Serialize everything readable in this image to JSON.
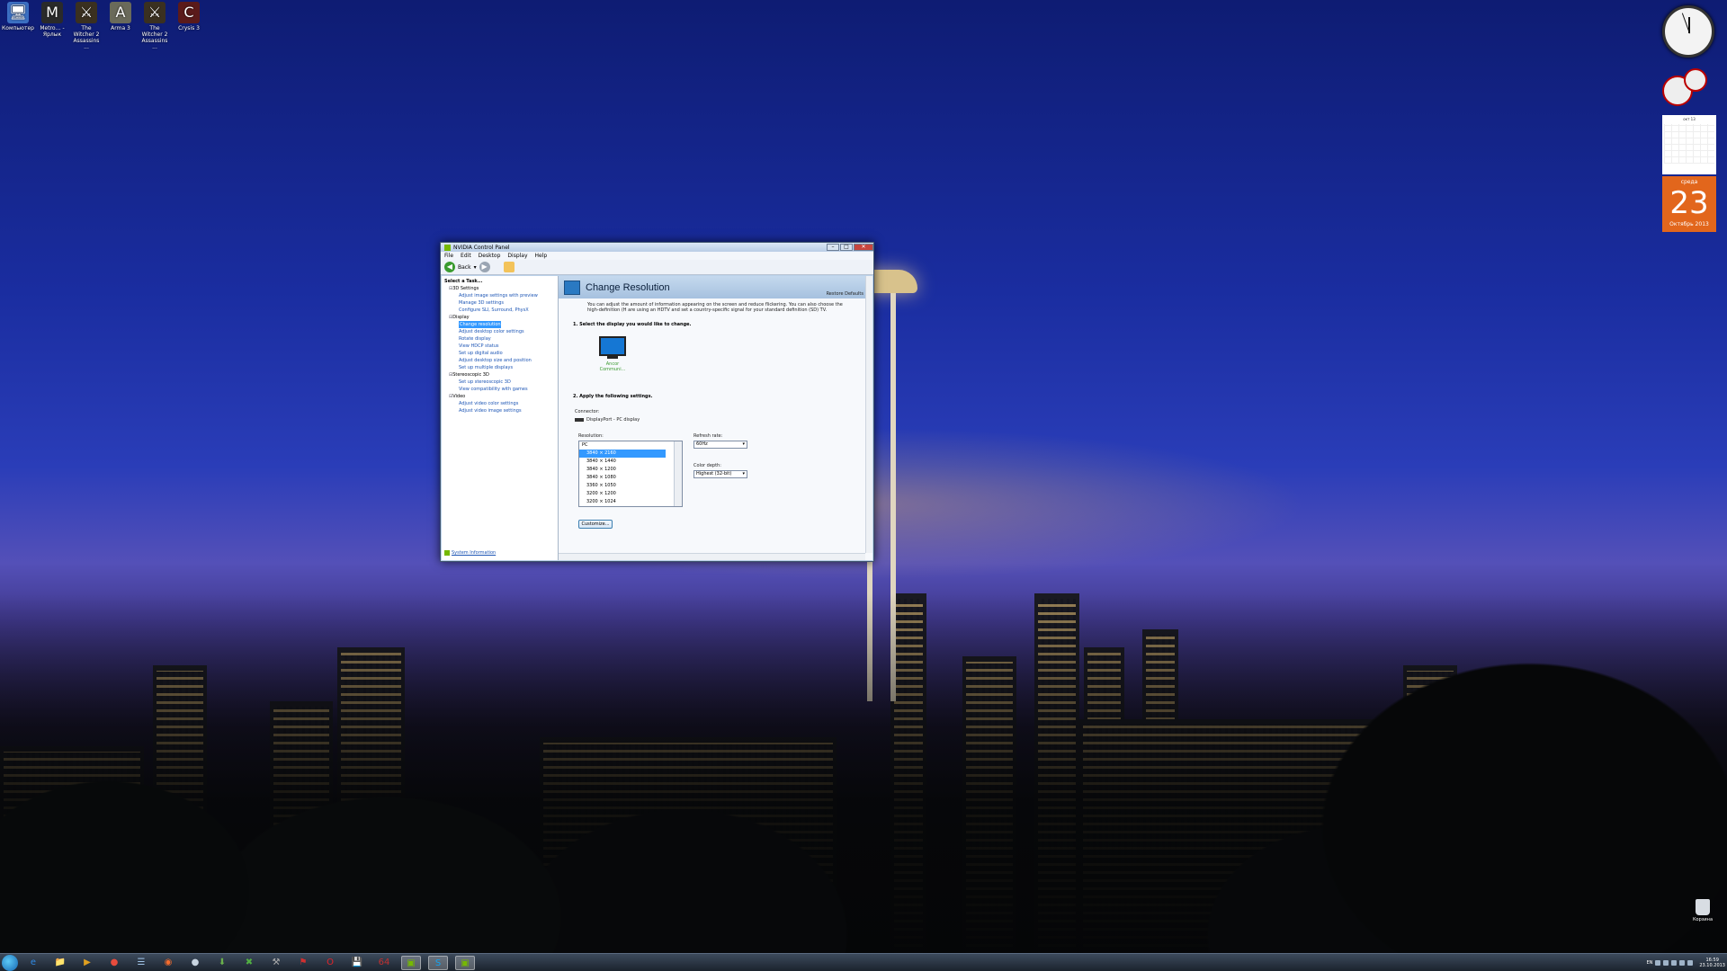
{
  "desktop": {
    "icons": [
      {
        "label": "Компьютер",
        "icon": "computer-icon",
        "glyph": "🖥",
        "bg": "#3b6fc2"
      },
      {
        "label": "Metro… - Ярлык",
        "icon": "metro-shortcut-icon",
        "glyph": "M",
        "bg": "#2a2a2a"
      },
      {
        "label": "The Witcher 2 Assassins ...",
        "icon": "witcher2-icon",
        "glyph": "⚔",
        "bg": "#3a3020"
      },
      {
        "label": "Arma 3",
        "icon": "arma3-icon",
        "glyph": "A",
        "bg": "#6a6a5a"
      },
      {
        "label": "The Witcher 2 Assassins ...",
        "icon": "witcher2-launcher-icon",
        "glyph": "⚔",
        "bg": "#3a3020"
      },
      {
        "label": "Crysis 3",
        "icon": "crysis3-icon",
        "glyph": "C",
        "bg": "#5a1a1a"
      }
    ]
  },
  "calendar": {
    "month_header": "окт 13",
    "day_name": "среда",
    "day_number": "23",
    "month_name": "Октябрь 2013"
  },
  "recycle_bin": {
    "label": "Корзина"
  },
  "window": {
    "title": "NVIDIA Control Panel",
    "menu": [
      "File",
      "Edit",
      "Desktop",
      "Display",
      "Help"
    ],
    "back_label": "Back",
    "task_header": "Select a Task...",
    "tree": [
      {
        "category": "3D Settings",
        "tasks": [
          "Adjust image settings with preview",
          "Manage 3D settings",
          "Configure SLI, Surround, PhysX"
        ]
      },
      {
        "category": "Display",
        "tasks": [
          "Change resolution",
          "Adjust desktop color settings",
          "Rotate display",
          "View HDCP status",
          "Set up digital audio",
          "Adjust desktop size and position",
          "Set up multiple displays"
        ]
      },
      {
        "category": "Stereoscopic 3D",
        "tasks": [
          "Set up stereoscopic 3D",
          "View compatibility with games"
        ]
      },
      {
        "category": "Video",
        "tasks": [
          "Adjust video color settings",
          "Adjust video image settings"
        ]
      }
    ],
    "selected_task": "Change resolution",
    "system_info": "System Information",
    "page": {
      "title": "Change Resolution",
      "restore_defaults": "Restore Defaults",
      "description": "You can adjust the amount of information appearing on the screen and reduce flickering. You can also choose the high-definition (H are using an HDTV and set a country-specific signal for your standard definition (SD) TV.",
      "step1": "1. Select the display you would like to change.",
      "display_label": "Ancor Communi...",
      "step2": "2. Apply the following settings.",
      "connector_label": "Connector:",
      "connector_value": "DisplayPort - PC display",
      "resolution_label": "Resolution:",
      "resolution_group": "PC",
      "resolutions": [
        "3840 × 2160",
        "3840 × 1440",
        "3840 × 1200",
        "3840 × 1080",
        "3360 × 1050",
        "3200 × 1200",
        "3200 × 1024"
      ],
      "selected_resolution": "3840 × 2160",
      "refresh_label": "Refresh rate:",
      "refresh_value": "60Hz",
      "depth_label": "Color depth:",
      "depth_value": "Highest (32-bit)",
      "customize_label": "Customize..."
    }
  },
  "taskbar": {
    "apps": [
      {
        "icon": "ie-icon",
        "glyph": "e",
        "color": "#2e8ae6"
      },
      {
        "icon": "explorer-icon",
        "glyph": "📁",
        "color": "#e8c060"
      },
      {
        "icon": "media-player-icon",
        "glyph": "▶",
        "color": "#e0a020"
      },
      {
        "icon": "chrome-icon",
        "glyph": "●",
        "color": "#e84c3d"
      },
      {
        "icon": "notepad-icon",
        "glyph": "☰",
        "color": "#a0c4e8"
      },
      {
        "icon": "origin-icon",
        "glyph": "◉",
        "color": "#f56c2d"
      },
      {
        "icon": "steam-icon",
        "glyph": "●",
        "color": "#c8d4e0"
      },
      {
        "icon": "torrent-icon",
        "glyph": "⬇",
        "color": "#6ab04c"
      },
      {
        "icon": "xbox-icon",
        "glyph": "✖",
        "color": "#52b043"
      },
      {
        "icon": "tool-icon",
        "glyph": "⚒",
        "color": "#b0b0b0"
      },
      {
        "icon": "antivirus-icon",
        "glyph": "⚑",
        "color": "#d03030"
      },
      {
        "icon": "opera-icon",
        "glyph": "O",
        "color": "#e0242c"
      },
      {
        "icon": "disk-icon",
        "glyph": "💾",
        "color": "#5080c0"
      },
      {
        "icon": "hardware-monitor-icon",
        "glyph": "64",
        "color": "#c03030"
      },
      {
        "icon": "nvidia-icon",
        "glyph": "▣",
        "color": "#76b900"
      },
      {
        "icon": "skype-icon",
        "glyph": "S",
        "color": "#12a5f4"
      },
      {
        "icon": "nvidia-panel-icon",
        "glyph": "▣",
        "color": "#76b900"
      }
    ],
    "tray": {
      "lang": "EN",
      "time": "16:59",
      "date": "23.10.2013"
    }
  }
}
